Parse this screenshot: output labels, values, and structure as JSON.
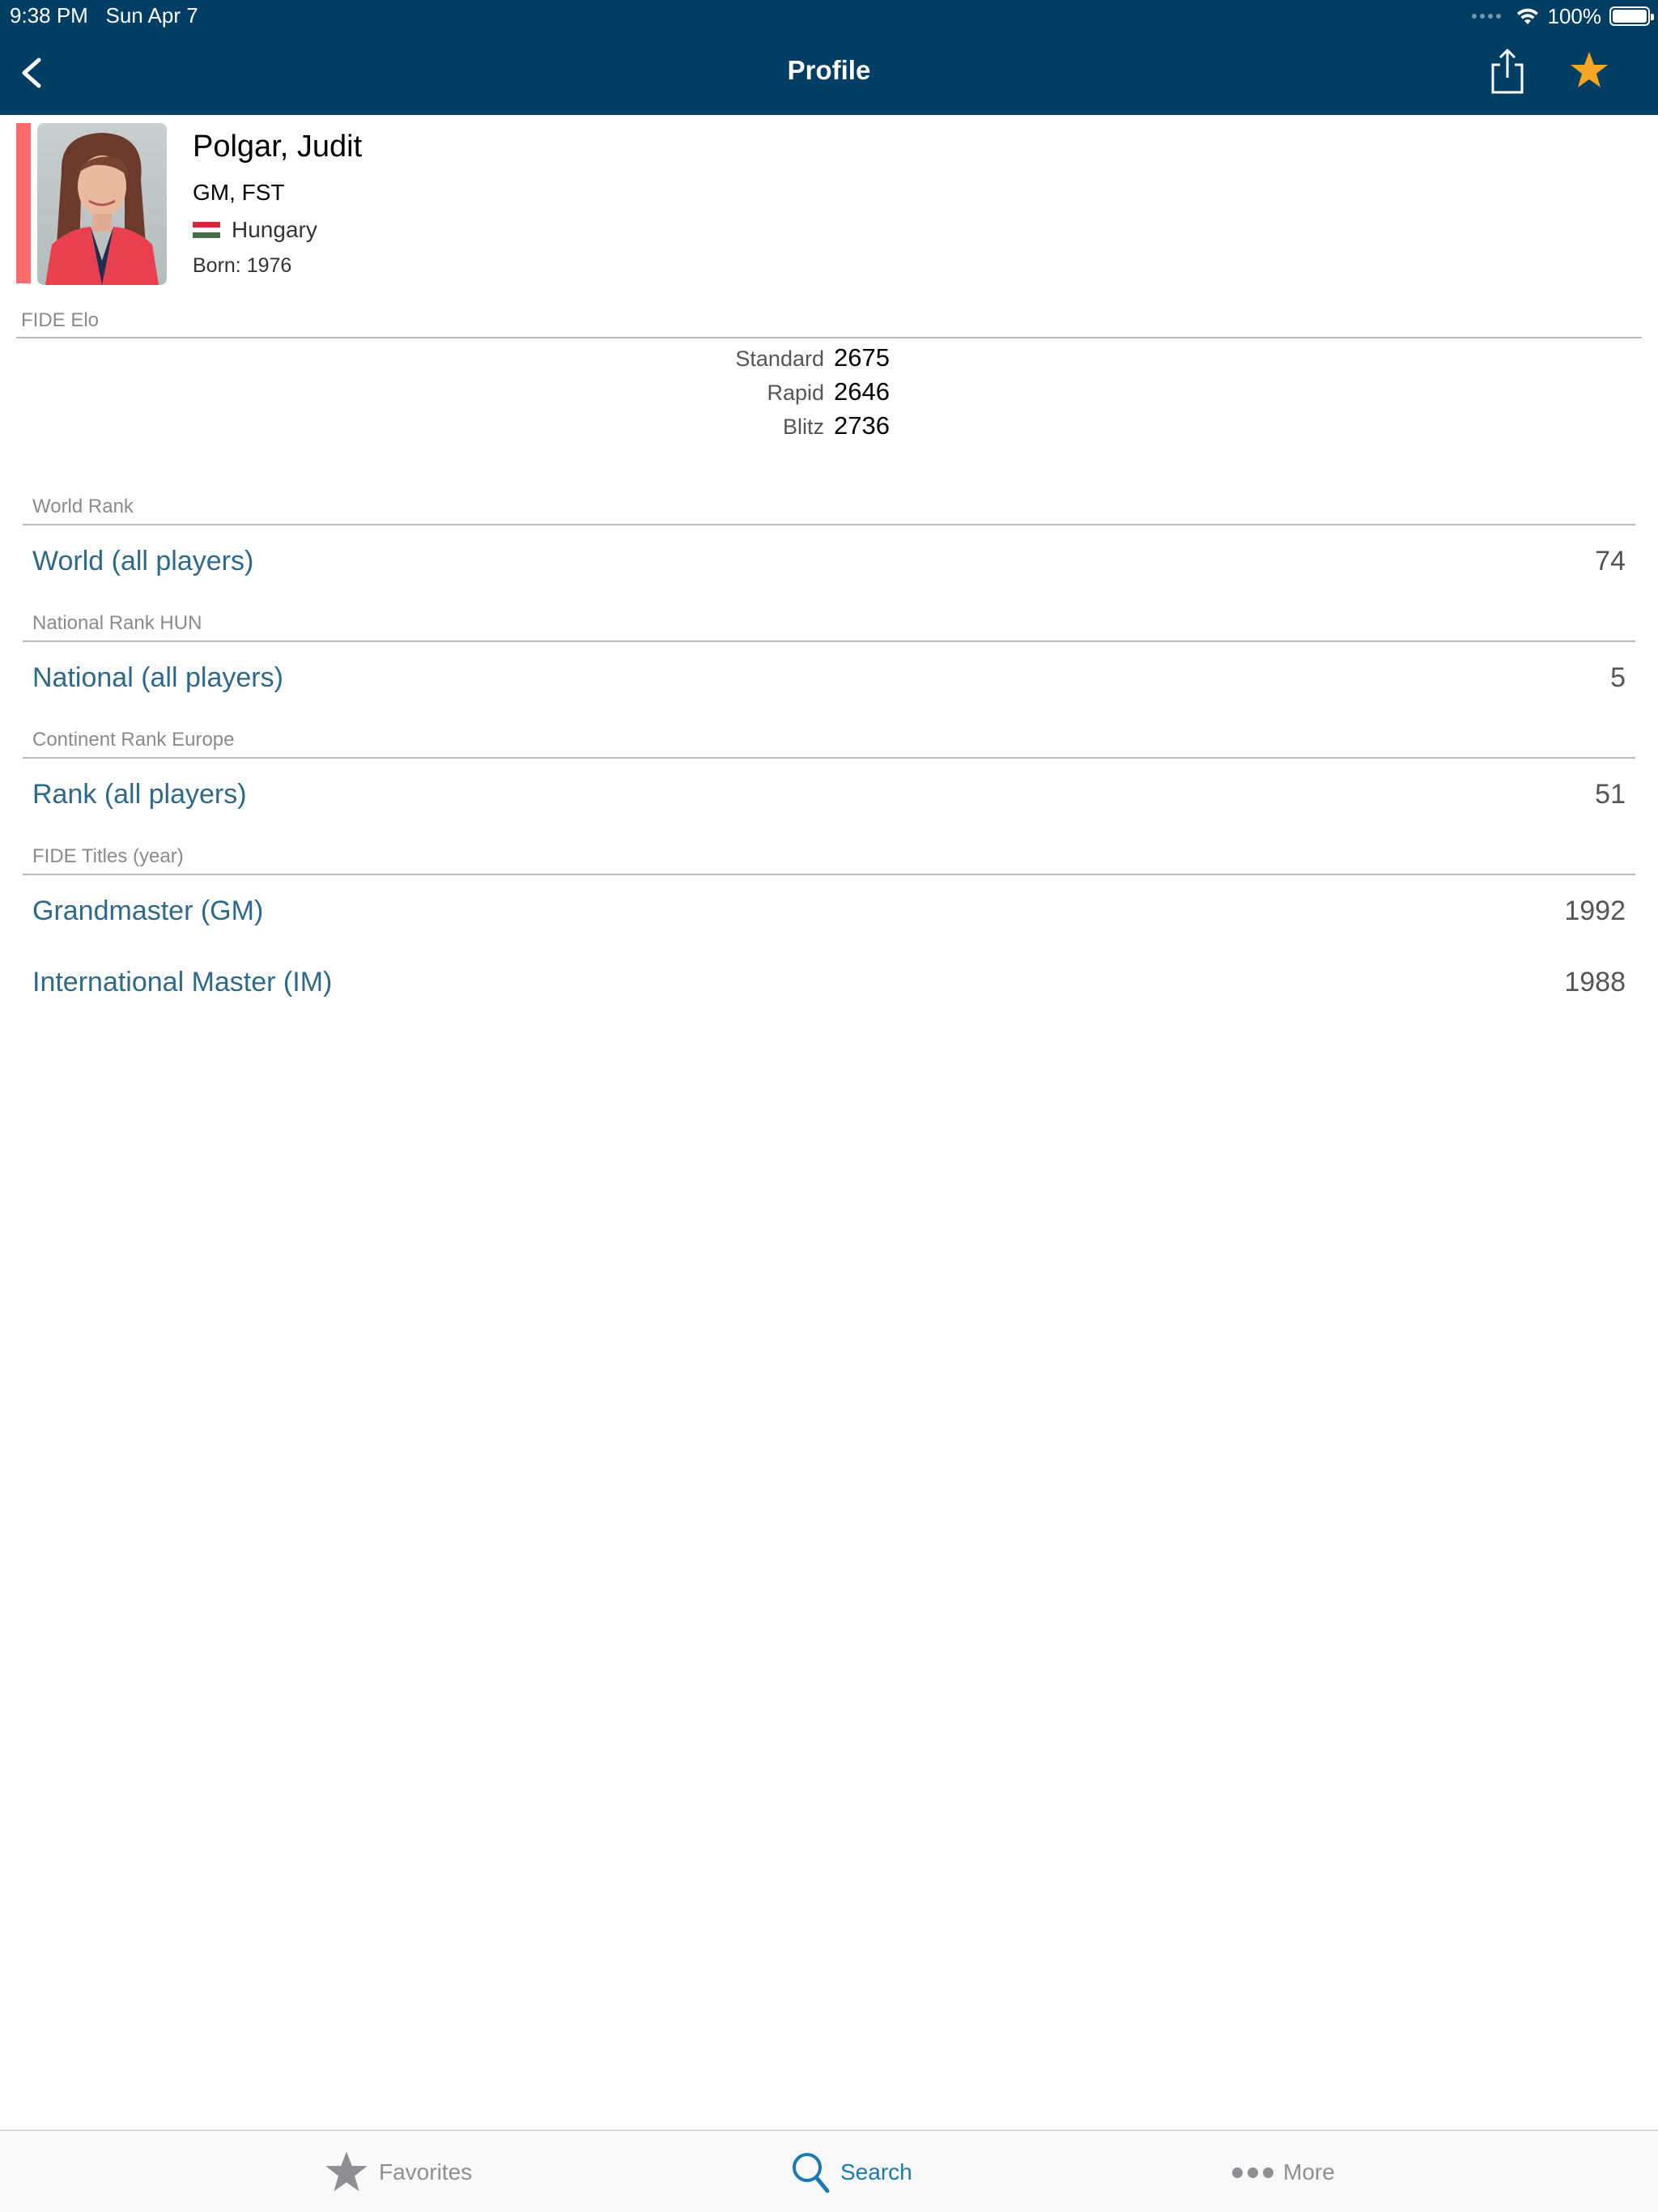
{
  "status_bar": {
    "time": "9:38 PM",
    "date": "Sun Apr 7",
    "battery": "100%",
    "battery_level": 1.0
  },
  "nav": {
    "title": "Profile",
    "accent_color": "#003f63",
    "favorite_color": "#f5a623",
    "icons": [
      "chevron-left-icon",
      "share-icon",
      "star-icon"
    ]
  },
  "profile": {
    "name": "Polgar, Judit",
    "titles": "GM, FST",
    "country": "Hungary",
    "born": "Born: 1976",
    "gender_color": "#ff6b6b"
  },
  "elo": {
    "header": "FIDE Elo",
    "ratings": [
      {
        "label": "Standard",
        "value": "2675"
      },
      {
        "label": "Rapid",
        "value": "2646"
      },
      {
        "label": "Blitz",
        "value": "2736"
      }
    ]
  },
  "world_rank": {
    "header": "World Rank",
    "rows": [
      {
        "label": "World (all players)",
        "value": "74"
      }
    ]
  },
  "national_rank": {
    "header": "National Rank HUN",
    "rows": [
      {
        "label": "National (all players)",
        "value": "5"
      }
    ]
  },
  "continent_rank": {
    "header": "Continent Rank Europe",
    "rows": [
      {
        "label": "Rank (all players)",
        "value": "51"
      }
    ]
  },
  "titles": {
    "header": "FIDE Titles (year)",
    "rows": [
      {
        "label": "Grandmaster (GM)",
        "value": "1992"
      },
      {
        "label": "International Master (IM)",
        "value": "1988"
      }
    ]
  },
  "tabbar": {
    "items": [
      {
        "label": "Favorites",
        "icon": "star-icon",
        "active": false
      },
      {
        "label": "Search",
        "icon": "search-icon",
        "active": true
      },
      {
        "label": "More",
        "icon": "more-icon",
        "active": false
      }
    ],
    "active_color": "#1a7ab0",
    "inactive_color": "#8e8e93"
  }
}
